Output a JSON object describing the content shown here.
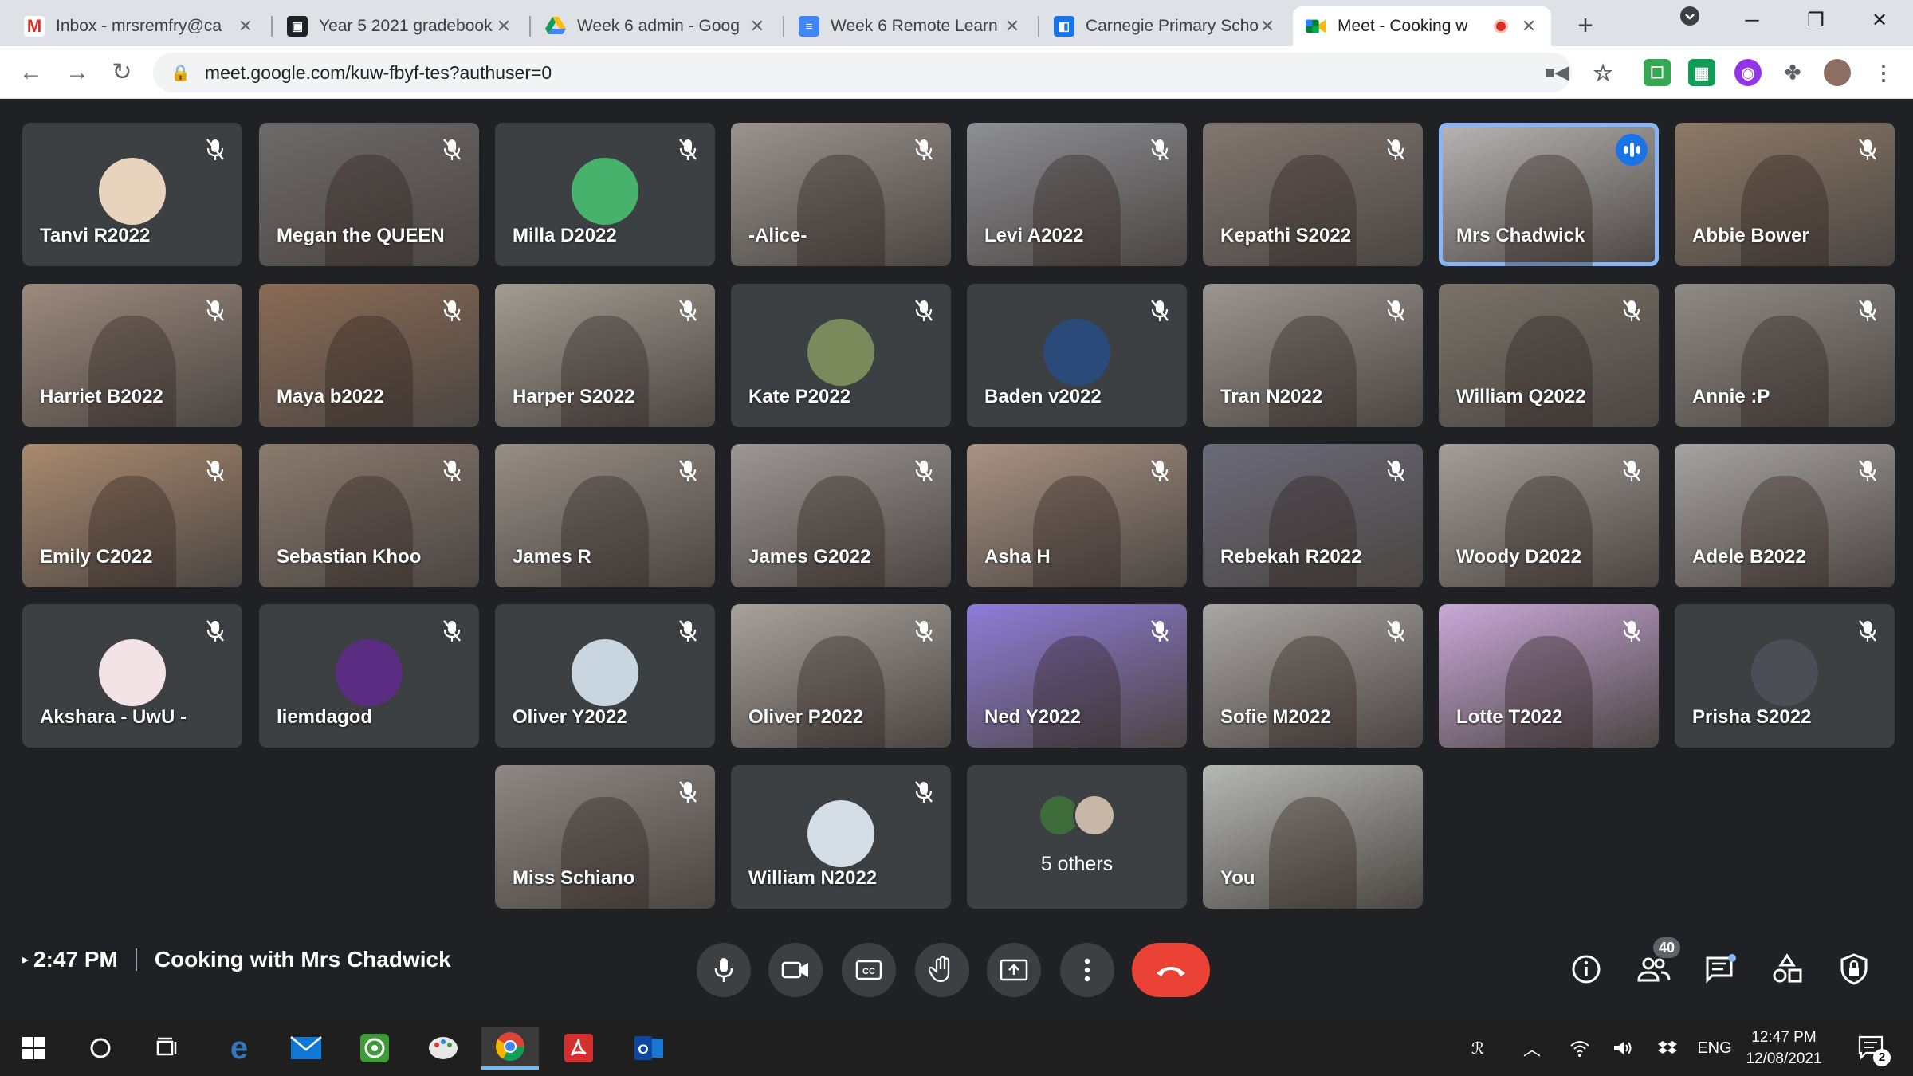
{
  "browser": {
    "tabs": [
      {
        "label": "Inbox - mrsremfry@ca",
        "icon": "gmail-icon",
        "active": false
      },
      {
        "label": "Year 5 2021 gradebook",
        "icon": "classroom-icon",
        "active": false
      },
      {
        "label": "Week 6 admin - Goog",
        "icon": "drive-icon",
        "active": false
      },
      {
        "label": "Week 6 Remote Learn",
        "icon": "docs-icon",
        "active": false
      },
      {
        "label": "Carnegie Primary Scho",
        "icon": "sites-icon",
        "active": false
      },
      {
        "label": "Meet - Cooking w",
        "icon": "meet-icon",
        "active": true,
        "recording": true
      }
    ],
    "url": "meet.google.com/kuw-fbyf-tes?authuser=0"
  },
  "meet": {
    "tiles": [
      {
        "name": "Tanvi R2022",
        "type": "avatar",
        "color": "#e8d3bd",
        "muted": true
      },
      {
        "name": "Megan the QUEEN",
        "type": "video",
        "bg": "#6e6a6a",
        "muted": true
      },
      {
        "name": "Milla D2022",
        "type": "avatar",
        "color": "#47b26b",
        "muted": true
      },
      {
        "name": "-Alice-",
        "type": "video",
        "bg": "#9a9390",
        "muted": true
      },
      {
        "name": "Levi A2022",
        "type": "video",
        "bg": "#8e8f94",
        "muted": true
      },
      {
        "name": "Kepathi S2022",
        "type": "video",
        "bg": "#827770",
        "muted": true
      },
      {
        "name": "Mrs Chadwick",
        "type": "video",
        "bg": "#b8b5b4",
        "muted": false,
        "speaking": true
      },
      {
        "name": "Abbie Bower",
        "type": "video",
        "bg": "#8d7a68",
        "muted": true
      },
      {
        "name": "Harriet B2022",
        "type": "video",
        "bg": "#9c8a7e",
        "muted": true
      },
      {
        "name": "Maya b2022",
        "type": "video",
        "bg": "#8a6b55",
        "muted": true
      },
      {
        "name": "Harper S2022",
        "type": "video",
        "bg": "#a39c92",
        "muted": true
      },
      {
        "name": "Kate P2022",
        "type": "avatar",
        "color": "#7c8a5b",
        "muted": true
      },
      {
        "name": "Baden v2022",
        "type": "avatar",
        "color": "#2a4a7a",
        "muted": true
      },
      {
        "name": "Tran N2022",
        "type": "video",
        "bg": "#9d9591",
        "muted": true
      },
      {
        "name": "William Q2022",
        "type": "video",
        "bg": "#7a7268",
        "muted": true
      },
      {
        "name": "Annie :P",
        "type": "video",
        "bg": "#8f8a86",
        "muted": true
      },
      {
        "name": "Emily C2022",
        "type": "video",
        "bg": "#a98a70",
        "muted": true
      },
      {
        "name": "Sebastian Khoo",
        "type": "video",
        "bg": "#8a7a6e",
        "muted": true
      },
      {
        "name": "James R",
        "type": "video",
        "bg": "#978e85",
        "muted": true
      },
      {
        "name": "James G2022",
        "type": "video",
        "bg": "#9c9794",
        "muted": true
      },
      {
        "name": "Asha H",
        "type": "video",
        "bg": "#a99384",
        "muted": true
      },
      {
        "name": "Rebekah R2022",
        "type": "video",
        "bg": "#6b6a78",
        "muted": true
      },
      {
        "name": "Woody D2022",
        "type": "video",
        "bg": "#a39e97",
        "muted": true
      },
      {
        "name": "Adele B2022",
        "type": "video",
        "bg": "#a7a3a2",
        "muted": true
      },
      {
        "name": "Akshara - UwU -",
        "type": "avatar",
        "color": "#f3e3e6",
        "muted": true
      },
      {
        "name": "liemdagod",
        "type": "avatar",
        "color": "#5b2d82",
        "muted": true
      },
      {
        "name": "Oliver Y2022",
        "type": "avatar",
        "color": "#c9d6e0",
        "muted": true
      },
      {
        "name": "Oliver P2022",
        "type": "video",
        "bg": "#a8a29b",
        "muted": true
      },
      {
        "name": "Ned Y2022",
        "type": "video",
        "bg": "#8f7cd9",
        "muted": true
      },
      {
        "name": "Sofie M2022",
        "type": "video",
        "bg": "#aaa6a3",
        "muted": true
      },
      {
        "name": "Lotte T2022",
        "type": "video",
        "bg": "#c9a8d8",
        "muted": true
      },
      {
        "name": "Prisha S2022",
        "type": "avatar",
        "color": "#4d4d55",
        "muted": true
      },
      {
        "name": "Miss Schiano",
        "type": "video",
        "bg": "#8e8782",
        "muted": true
      },
      {
        "name": "William N2022",
        "type": "avatar",
        "color": "#d5dde4",
        "muted": true
      },
      {
        "name": "",
        "type": "others",
        "others_label": "5 others",
        "muted": false
      },
      {
        "name": "You",
        "type": "video",
        "bg": "#b6b8b4",
        "muted": false
      }
    ],
    "bottom": {
      "time": "2:47 PM",
      "meeting_title": "Cooking with Mrs Chadwick",
      "participants_count": "40"
    }
  },
  "taskbar": {
    "language": "ENG",
    "clock_time": "12:47 PM",
    "clock_date": "12/08/2021",
    "notifications": "2"
  }
}
